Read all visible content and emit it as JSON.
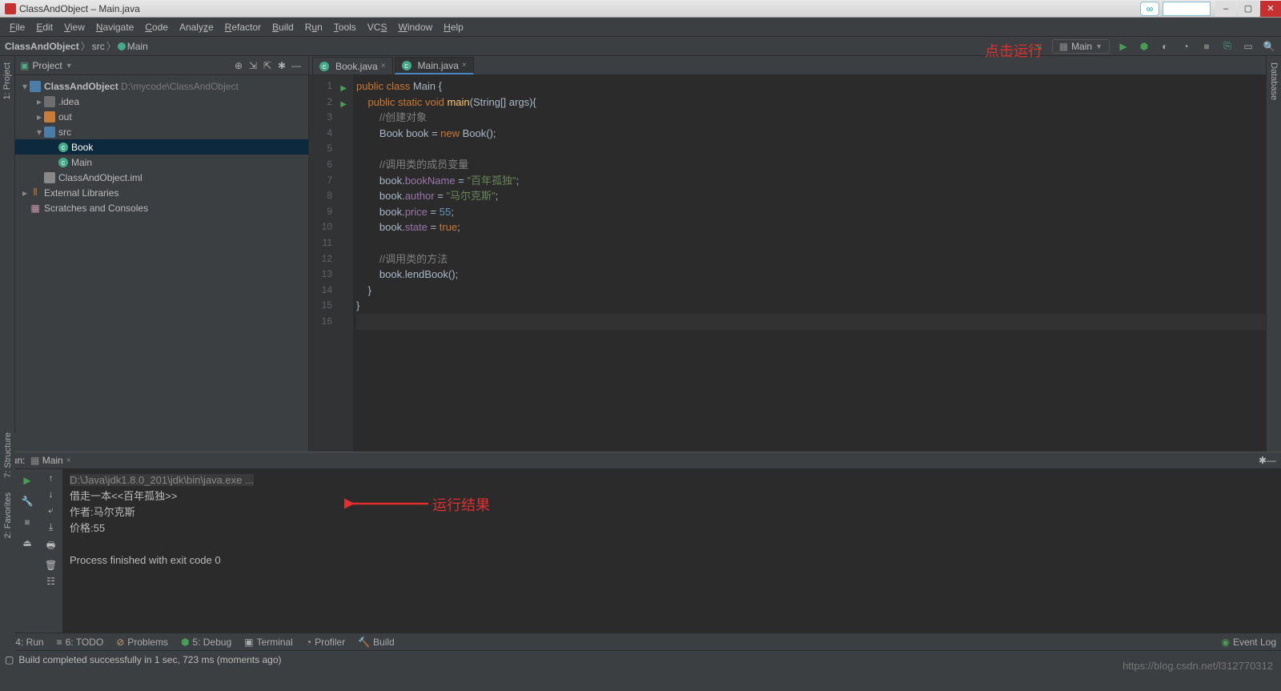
{
  "window": {
    "title": "ClassAndObject – Main.java"
  },
  "menu": [
    "File",
    "Edit",
    "View",
    "Navigate",
    "Code",
    "Analyze",
    "Refactor",
    "Build",
    "Run",
    "Tools",
    "VCS",
    "Window",
    "Help"
  ],
  "breadcrumb": {
    "project": "ClassAndObject",
    "folder": "src",
    "file": "Main"
  },
  "runconfig": "Main",
  "projectToolLabel": "Project",
  "sideTabs": {
    "project": "1: Project",
    "structure": "7: Structure",
    "favorites": "2: Favorites",
    "database": "Database"
  },
  "tree": {
    "root": {
      "name": "ClassAndObject",
      "path": "D:\\mycode\\ClassAndObject"
    },
    "idea": ".idea",
    "out": "out",
    "src": "src",
    "book": "Book",
    "main": "Main",
    "iml": "ClassAndObject.iml",
    "libs": "External Libraries",
    "scratches": "Scratches and Consoles"
  },
  "tabs": [
    {
      "label": "Book.java",
      "active": false
    },
    {
      "label": "Main.java",
      "active": true
    }
  ],
  "code": {
    "lines": [
      {
        "n": 1,
        "run": true,
        "html": "<span class='kw'>public class</span> Main {"
      },
      {
        "n": 2,
        "run": true,
        "html": "    <span class='kw'>public static void</span> <span class='fn'>main</span>(String[] args){"
      },
      {
        "n": 3,
        "html": "        <span class='cmt'>//创建对象</span>"
      },
      {
        "n": 4,
        "html": "        Book book = <span class='kw'>new</span> Book();"
      },
      {
        "n": 5,
        "html": ""
      },
      {
        "n": 6,
        "html": "        <span class='cmt'>//调用类的成员变量</span>"
      },
      {
        "n": 7,
        "html": "        book.<span class='fld'>bookName</span> = <span class='str'>\"百年孤独\"</span>;"
      },
      {
        "n": 8,
        "html": "        book.<span class='fld'>author</span> = <span class='str'>\"马尔克斯\"</span>;"
      },
      {
        "n": 9,
        "html": "        book.<span class='fld'>price</span> = <span class='num'>55</span>;"
      },
      {
        "n": 10,
        "html": "        book.<span class='fld'>state</span> = <span class='kw'>true</span>;"
      },
      {
        "n": 11,
        "html": ""
      },
      {
        "n": 12,
        "html": "        <span class='cmt'>//调用类的方法</span>"
      },
      {
        "n": 13,
        "html": "        book.lendBook();"
      },
      {
        "n": 14,
        "html": "    }"
      },
      {
        "n": 15,
        "html": "}"
      },
      {
        "n": 16,
        "html": "",
        "caret": true
      }
    ]
  },
  "annotations": {
    "run": "点击运行",
    "result": "运行结果"
  },
  "run": {
    "label": "Run:",
    "config": "Main",
    "lines": [
      "D:\\Java\\jdk1.8.0_201\\jdk\\bin\\java.exe ...",
      "借走一本<<百年孤独>>",
      "作者:马尔克斯",
      "价格:55",
      "",
      "Process finished with exit code 0"
    ]
  },
  "bottomTabs": {
    "run": "4: Run",
    "todo": "6: TODO",
    "problems": "Problems",
    "debug": "5: Debug",
    "terminal": "Terminal",
    "profiler": "Profiler",
    "build": "Build",
    "eventlog": "Event Log"
  },
  "status": "Build completed successfully in 1 sec, 723 ms (moments ago)",
  "watermark": "https://blog.csdn.net/l312770312"
}
